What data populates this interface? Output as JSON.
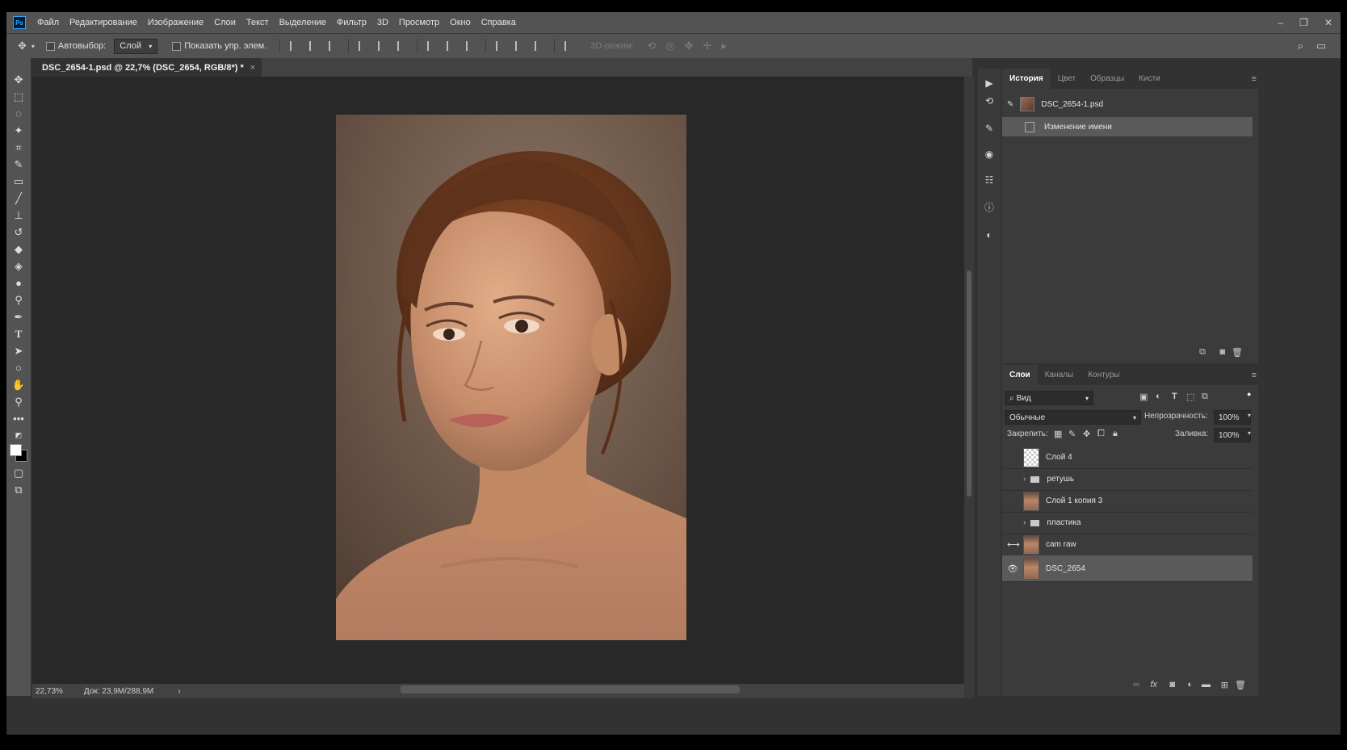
{
  "menubar": {
    "app_icon": "Ps",
    "items": [
      "Файл",
      "Редактирование",
      "Изображение",
      "Слои",
      "Текст",
      "Выделение",
      "Фильтр",
      "3D",
      "Просмотр",
      "Окно",
      "Справка"
    ]
  },
  "options": {
    "autoselect_label": "Автовыбор:",
    "autoselect_value": "Слой",
    "show_controls_label": "Показать упр. элем.",
    "mode_3d_label": "3D-режим:"
  },
  "document": {
    "tab_title": "DSC_2654-1.psd @ 22,7% (DSC_2654, RGB/8*) *",
    "close": "×"
  },
  "status": {
    "zoom": "22,73%",
    "doc_info": "Док: 23,9M/288,9M",
    "arrow": "›"
  },
  "history_panel": {
    "tabs": [
      "История",
      "Цвет",
      "Образцы",
      "Кисти"
    ],
    "snapshot": "DSC_2654-1.psd",
    "steps": [
      "Изменение имени"
    ]
  },
  "layers_panel": {
    "tabs": [
      "Слои",
      "Каналы",
      "Контуры"
    ],
    "filter_label": "Вид",
    "blend_mode": "Обычные",
    "opacity_label": "Непрозрачность:",
    "opacity_value": "100%",
    "lock_label": "Закрепить:",
    "fill_label": "Заливка:",
    "fill_value": "100%",
    "layers": [
      {
        "name": "Слой 4",
        "kind": "layer",
        "visible": false,
        "selected": false
      },
      {
        "name": "ретушь",
        "kind": "group",
        "visible": false,
        "selected": false
      },
      {
        "name": "Слой 1 копия 3",
        "kind": "layer",
        "visible": false,
        "selected": false
      },
      {
        "name": "пластика",
        "kind": "group",
        "visible": false,
        "selected": false
      },
      {
        "name": "cam raw",
        "kind": "smart",
        "visible": false,
        "selected": false
      },
      {
        "name": "DSC_2654",
        "kind": "smart",
        "visible": true,
        "selected": true
      }
    ]
  },
  "colors": {
    "ui_dark": "#323232",
    "ui_mid": "#535353",
    "canvas_bg": "#282828",
    "selection": "#5a5a5a",
    "ps_blue": "#31a8ff"
  }
}
